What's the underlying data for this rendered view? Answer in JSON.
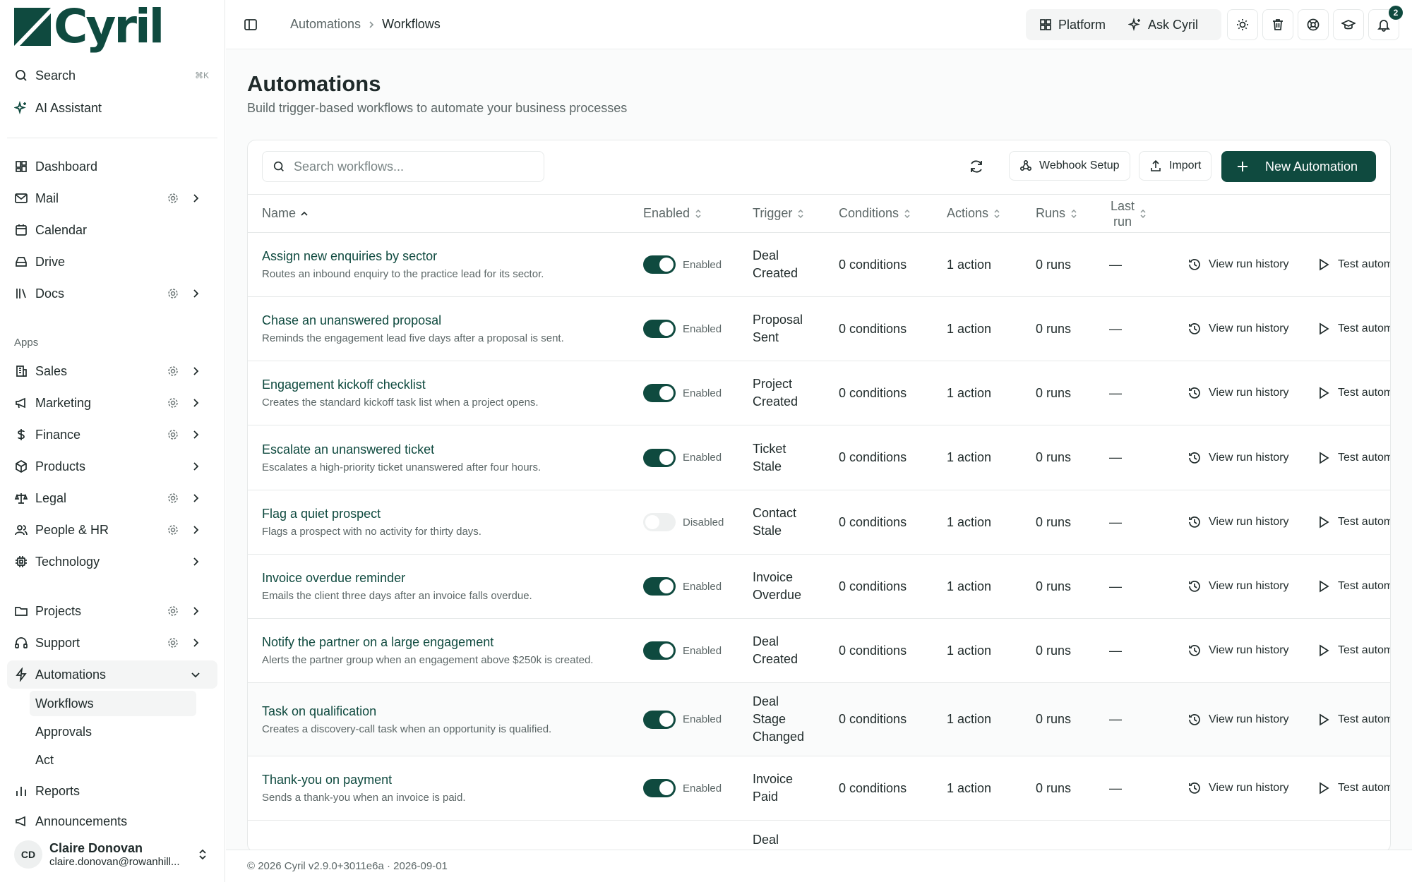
{
  "brand": {
    "name": "Cyril",
    "color": "#0f4a3f"
  },
  "sidebar": {
    "search_label": "Search",
    "search_shortcut": "⌘K",
    "ai_label": "AI Assistant",
    "dashboard": "Dashboard",
    "mail": "Mail",
    "calendar": "Calendar",
    "drive": "Drive",
    "docs": "Docs",
    "apps_heading": "Apps",
    "sales": "Sales",
    "marketing": "Marketing",
    "finance": "Finance",
    "products": "Products",
    "legal": "Legal",
    "people": "People & HR",
    "technology": "Technology",
    "projects": "Projects",
    "support": "Support",
    "automations": "Automations",
    "automations_sub": [
      "Workflows",
      "Approvals",
      "Act"
    ],
    "reports": "Reports",
    "announcements": "Announcements",
    "user": {
      "initials": "CD",
      "name": "Claire Donovan",
      "email": "claire.donovan@rowanhill..."
    }
  },
  "topbar": {
    "breadcrumb": [
      "Automations",
      "Workflows"
    ],
    "platform_label": "Platform",
    "ask_label": "Ask Cyril",
    "notification_count": "2"
  },
  "page": {
    "title": "Automations",
    "subtitle": "Build trigger-based workflows to automate your business processes"
  },
  "toolbar": {
    "search_placeholder": "Search workflows...",
    "webhook_label": "Webhook Setup",
    "import_label": "Import",
    "new_label": "New Automation"
  },
  "table": {
    "headers": {
      "name": "Name",
      "enabled": "Enabled",
      "trigger": "Trigger",
      "conditions": "Conditions",
      "actions": "Actions",
      "runs": "Runs",
      "last_run_1": "Last",
      "last_run_2": "run"
    },
    "view_history_label": "View run history",
    "test_label": "Test autom",
    "rows": [
      {
        "name": "Assign new enquiries by sector",
        "desc": "Routes an inbound enquiry to the practice lead for its sector.",
        "enabled": true,
        "status": "Enabled",
        "trigger": [
          "Deal",
          "Created"
        ],
        "conditions": "0 conditions",
        "actions": "1 action",
        "runs": "0 runs",
        "last_run": "—"
      },
      {
        "name": "Chase an unanswered proposal",
        "desc": "Reminds the engagement lead five days after a proposal is sent.",
        "enabled": true,
        "status": "Enabled",
        "trigger": [
          "Proposal",
          "Sent"
        ],
        "conditions": "0 conditions",
        "actions": "1 action",
        "runs": "0 runs",
        "last_run": "—"
      },
      {
        "name": "Engagement kickoff checklist",
        "desc": "Creates the standard kickoff task list when a project opens.",
        "enabled": true,
        "status": "Enabled",
        "trigger": [
          "Project",
          "Created"
        ],
        "conditions": "0 conditions",
        "actions": "1 action",
        "runs": "0 runs",
        "last_run": "—"
      },
      {
        "name": "Escalate an unanswered ticket",
        "desc": "Escalates a high-priority ticket unanswered after four hours.",
        "enabled": true,
        "status": "Enabled",
        "trigger": [
          "Ticket",
          "Stale"
        ],
        "conditions": "0 conditions",
        "actions": "1 action",
        "runs": "0 runs",
        "last_run": "—"
      },
      {
        "name": "Flag a quiet prospect",
        "desc": "Flags a prospect with no activity for thirty days.",
        "enabled": false,
        "status": "Disabled",
        "trigger": [
          "Contact",
          "Stale"
        ],
        "conditions": "0 conditions",
        "actions": "1 action",
        "runs": "0 runs",
        "last_run": "—"
      },
      {
        "name": "Invoice overdue reminder",
        "desc": "Emails the client three days after an invoice falls overdue.",
        "enabled": true,
        "status": "Enabled",
        "trigger": [
          "Invoice",
          "Overdue"
        ],
        "conditions": "0 conditions",
        "actions": "1 action",
        "runs": "0 runs",
        "last_run": "—"
      },
      {
        "name": "Notify the partner on a large engagement",
        "desc": "Alerts the partner group when an engagement above $250k is created.",
        "enabled": true,
        "status": "Enabled",
        "trigger": [
          "Deal",
          "Created"
        ],
        "conditions": "0 conditions",
        "actions": "1 action",
        "runs": "0 runs",
        "last_run": "—"
      },
      {
        "name": "Task on qualification",
        "desc": "Creates a discovery-call task when an opportunity is qualified.",
        "enabled": true,
        "status": "Enabled",
        "trigger": [
          "Deal",
          "Stage",
          "Changed"
        ],
        "conditions": "0 conditions",
        "actions": "1 action",
        "runs": "0 runs",
        "last_run": "—"
      },
      {
        "name": "Thank-you on payment",
        "desc": "Sends a thank-you when an invoice is paid.",
        "enabled": true,
        "status": "Enabled",
        "trigger": [
          "Invoice",
          "Paid"
        ],
        "conditions": "0 conditions",
        "actions": "1 action",
        "runs": "0 runs",
        "last_run": "—"
      }
    ],
    "partial_row_trigger": "Deal"
  },
  "footer": {
    "text": "© 2026 Cyril v2.9.0+3011e6a · 2026-09-01"
  }
}
